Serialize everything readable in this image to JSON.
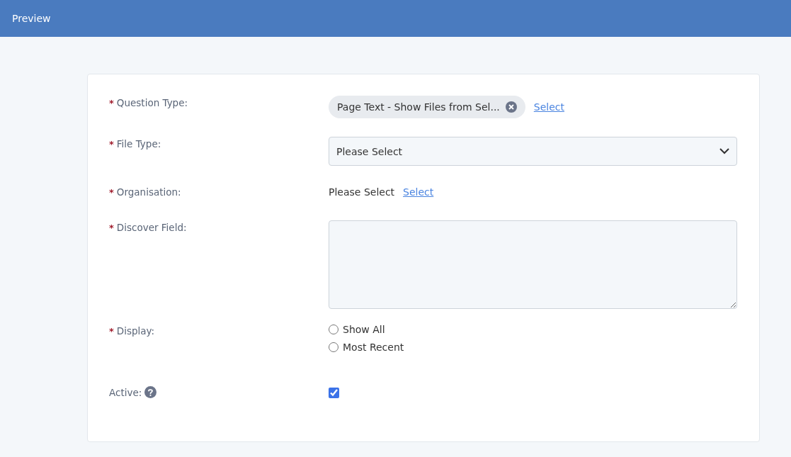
{
  "header": {
    "title": "Preview"
  },
  "fields": [
    {
      "kind": "tag",
      "required_mark": "*",
      "label": "Question Type:",
      "tag": "Page Text - Show Files from Sel...",
      "link": "Select"
    },
    {
      "kind": "select",
      "required_mark": "*",
      "label": "File Type:",
      "value": "Please Select"
    },
    {
      "kind": "picker",
      "required_mark": "*",
      "label": "Organisation:",
      "value": "Please Select",
      "link": "Select"
    },
    {
      "kind": "textarea",
      "required_mark": "*",
      "label": "Discover Field:"
    },
    {
      "kind": "radios",
      "required_mark": "*",
      "label": "Display:",
      "options": [
        {
          "label": "Show All",
          "selected": false
        },
        {
          "label": "Most Recent",
          "selected": false
        }
      ]
    },
    {
      "kind": "checkbox",
      "label": "Active:",
      "help": true,
      "checked": true
    }
  ]
}
